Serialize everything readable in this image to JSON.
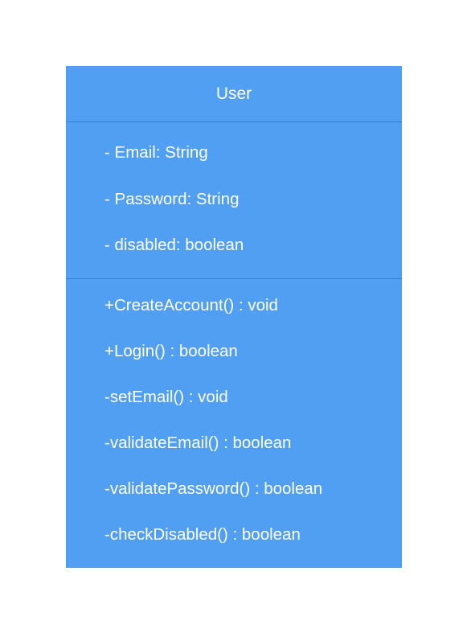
{
  "class": {
    "name": "User",
    "attributes": [
      "- Email: String",
      "- Password: String",
      "- disabled: boolean"
    ],
    "methods": [
      "+CreateAccount() : void",
      "+Login() : boolean",
      "-setEmail() : void",
      "-validateEmail() : boolean",
      "-validatePassword() : boolean",
      "-checkDisabled() : boolean"
    ]
  },
  "colors": {
    "box_fill": "#519FF2",
    "divider": "#2F7FD6",
    "text": "#FFFFFF",
    "background": "#FFFFFF"
  }
}
